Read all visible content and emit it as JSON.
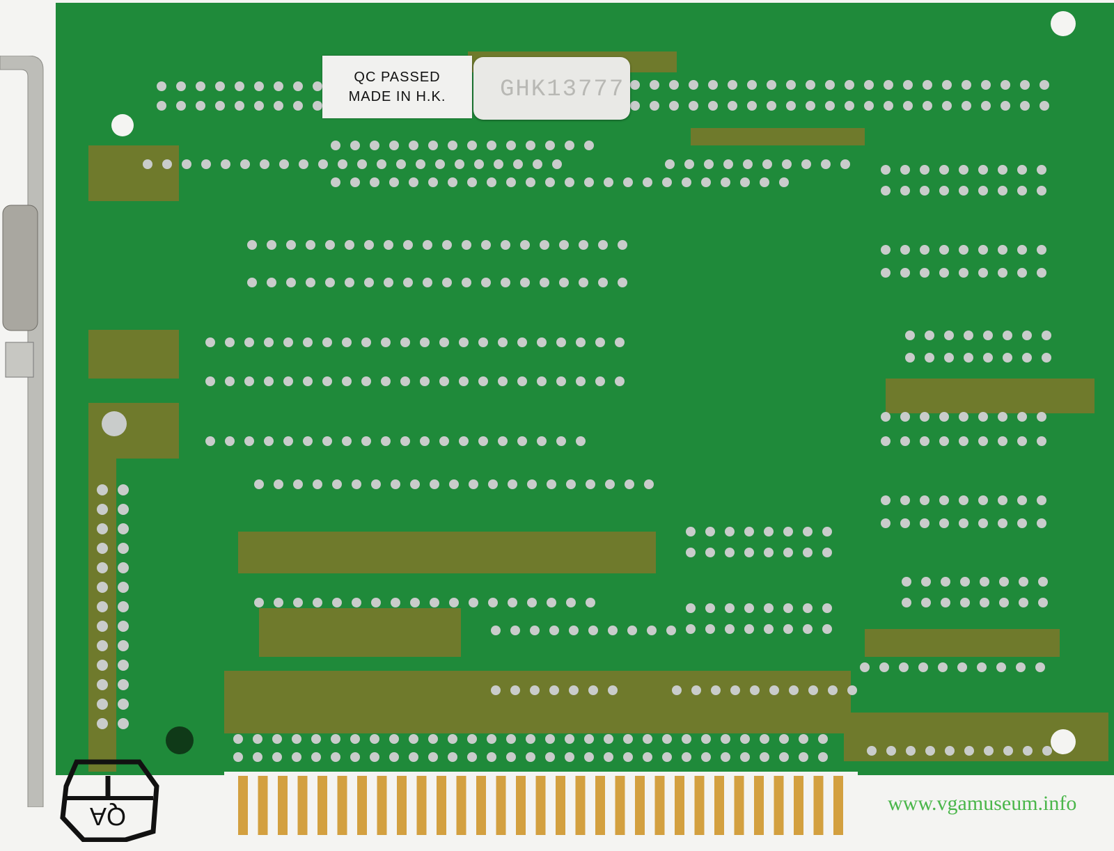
{
  "image": {
    "subject": "pcb-solder-side",
    "colors": {
      "board": "#1f8a3a",
      "ground_plane": "#6f7a2c",
      "pad": "#c9cccb",
      "gold_finger": "#d3a040",
      "bracket": "#b9b9b4"
    }
  },
  "qc_label": {
    "line1": "QC PASSED",
    "line2": "MADE  IN  H.K."
  },
  "serial_sticker": {
    "text": "GHK13777"
  },
  "stamp": {
    "text": "QA 1"
  },
  "watermark": {
    "text": "www.vgamuseum.info"
  }
}
